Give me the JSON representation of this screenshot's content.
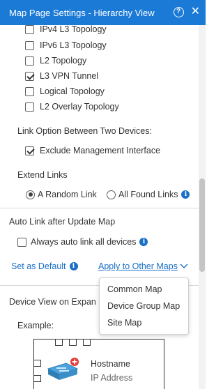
{
  "header": {
    "title": "Map Page Settings - Hierarchy View",
    "help_icon": "question-circle-icon",
    "close_icon": "close-icon",
    "color": "#1a7ad6"
  },
  "topology_options": [
    {
      "label": "IPv4 L3 Topology",
      "checked": false
    },
    {
      "label": "IPv6 L3 Topology",
      "checked": false
    },
    {
      "label": "L2 Topology",
      "checked": false
    },
    {
      "label": "L3 VPN Tunnel",
      "checked": true
    },
    {
      "label": "Logical Topology",
      "checked": false
    },
    {
      "label": "L2 Overlay Topology",
      "checked": false
    }
  ],
  "link_option": {
    "heading": "Link Option Between Two Devices:",
    "exclude_mgmt": {
      "label": "Exclude Management Interface",
      "checked": true
    }
  },
  "extend_links": {
    "heading": "Extend Links",
    "options": [
      {
        "label": "A Random Link",
        "selected": true
      },
      {
        "label": "All Found Links",
        "selected": false
      }
    ]
  },
  "auto_link": {
    "heading": "Auto Link after Update Map",
    "always": {
      "label": "Always auto link all devices",
      "checked": false
    }
  },
  "actions": {
    "set_default": "Set as Default",
    "apply_other": "Apply to Other Maps"
  },
  "apply_menu": {
    "items": [
      "Common Map",
      "Device Group Map",
      "Site Map"
    ]
  },
  "device_view": {
    "heading": "Device View on Expan",
    "example_label": "Example:",
    "hostname": "Hostname",
    "ip": "IP Address"
  },
  "colors": {
    "accent": "#1a7ad6",
    "link": "#1a6fc7",
    "text": "#333333"
  }
}
